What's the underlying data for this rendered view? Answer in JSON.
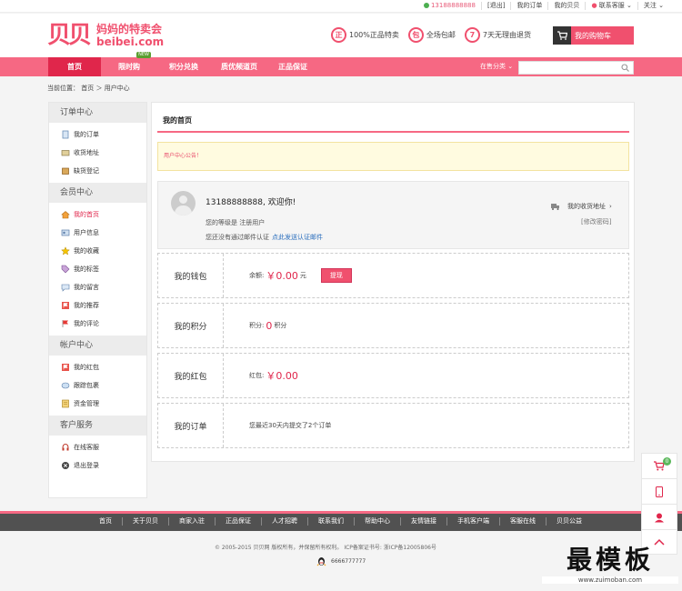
{
  "topbar": {
    "phone": "13188888888",
    "logout": "[退出]",
    "my_orders": "我的订单",
    "my_beibei": "我的贝贝",
    "service": "联系客服",
    "follow": "关注"
  },
  "header": {
    "logo_cn": "妈妈的特卖会",
    "logo_en": "beibei.com",
    "promises": [
      {
        "icon": "正",
        "text": "100%正品特卖"
      },
      {
        "icon": "包",
        "text": "全场包邮"
      },
      {
        "icon": "7",
        "text": "7天无理由退货"
      }
    ],
    "cart": "我的购物车"
  },
  "nav": {
    "items": [
      "首页",
      "限时购",
      "积分兑换",
      "质优频道页",
      "正品保证"
    ],
    "new_badge": "NEW",
    "category": "在售分类"
  },
  "breadcrumb": {
    "text": "当前位置： 首页 ＞ 用户中心"
  },
  "sidebar": {
    "sections": [
      {
        "title": "订单中心",
        "items": [
          "我的订单",
          "收货地址",
          "缺货登记"
        ]
      },
      {
        "title": "会员中心",
        "items": [
          "我的首页",
          "用户信息",
          "我的收藏",
          "我的标签",
          "我的留言",
          "我的推荐",
          "我的评论"
        ]
      },
      {
        "title": "帐户中心",
        "items": [
          "我的红包",
          "跟踪包裹",
          "资金管理"
        ]
      },
      {
        "title": "客户服务",
        "items": [
          "在线客服",
          "退出登录"
        ]
      }
    ]
  },
  "main": {
    "title": "我的首页",
    "notice": "用户中心公告！",
    "welcome": {
      "username": "13188888888, 欢迎你!",
      "level": "您的等级是  注册用户",
      "verify": "您还没有通过邮件认证",
      "verify_link": "点此发送认证邮件",
      "address": "我的收货地址",
      "change_pwd": "[修改密码]"
    },
    "wallet": {
      "label": "我的钱包",
      "prefix": "余额:",
      "amount": "￥0.00",
      "unit": "元",
      "button": "提现"
    },
    "points": {
      "label": "我的积分",
      "prefix": "积分:",
      "amount": "0",
      "unit": "积分"
    },
    "redpacket": {
      "label": "我的红包",
      "prefix": "红包:",
      "amount": "￥0.00"
    },
    "orders": {
      "label": "我的订单",
      "text": "您最近30天内提交了2个订单"
    }
  },
  "footer": {
    "links": [
      "首页",
      "关于贝贝",
      "商家入驻",
      "正品保证",
      "人才招聘",
      "联系我们",
      "帮助中心",
      "友情链接",
      "手机客户端",
      "客服在线",
      "贝贝公益"
    ],
    "copyright": "© 2005-2015 贝贝网 版权所有，并保留所有权利。 ICP备案证书号: 浙ICP备12005806号",
    "qq": "6666777777"
  },
  "float": {
    "cart_count": "0"
  },
  "watermark": {
    "big": "最模板",
    "url": "www.zuimoban.com"
  },
  "colors": {
    "brand": "#f66883",
    "accent": "#e0264b",
    "link": "#2a6ebd"
  }
}
